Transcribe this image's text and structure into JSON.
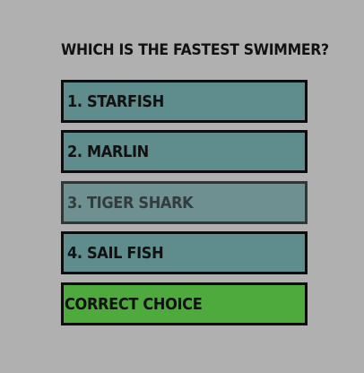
{
  "quiz": {
    "question": "WHICH IS THE FASTEST SWIMMER?",
    "options": [
      {
        "label": "1. STARFISH"
      },
      {
        "label": "2. MARLIN"
      },
      {
        "label": "3. TIGER SHARK"
      },
      {
        "label": "4. SAIL FISH"
      }
    ],
    "feedback": "CORRECT CHOICE"
  },
  "colors": {
    "background": "#b0b0b0",
    "option": "#5f8c8c",
    "option_dimmed": "#6f9090",
    "correct": "#4faa3d",
    "border": "#0d0d0d"
  }
}
